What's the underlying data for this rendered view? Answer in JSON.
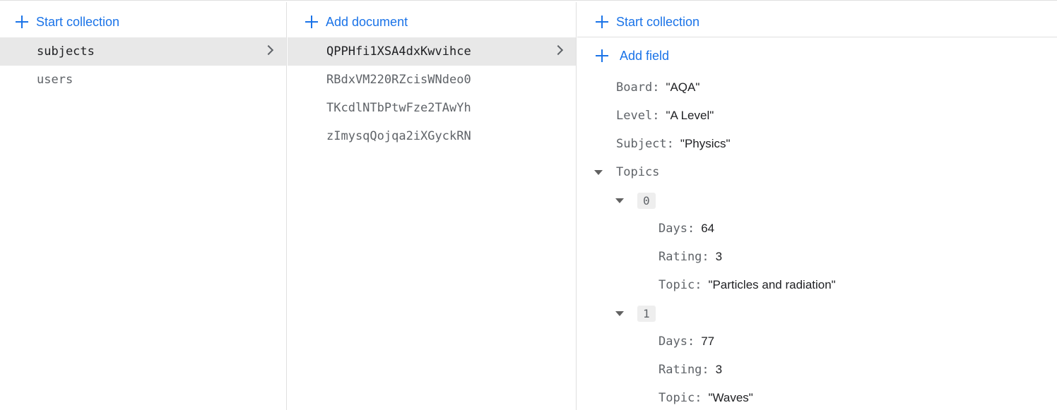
{
  "collections_panel": {
    "add_label": "Start collection",
    "items": [
      {
        "label": "subjects",
        "selected": true
      },
      {
        "label": "users",
        "selected": false
      }
    ]
  },
  "documents_panel": {
    "add_label": "Add document",
    "items": [
      {
        "label": "QPPHfi1XSA4dxKwvihce",
        "selected": true
      },
      {
        "label": "RBdxVM220RZcisWNdeo0",
        "selected": false
      },
      {
        "label": "TKcdlNTbPtwFze2TAwYh",
        "selected": false
      },
      {
        "label": "zImysqQojqa2iXGyckRN",
        "selected": false
      }
    ]
  },
  "document_panel": {
    "start_collection_label": "Start collection",
    "add_field_label": "Add field",
    "fields": {
      "board": {
        "key": "Board",
        "value": "\"AQA\""
      },
      "level": {
        "key": "Level",
        "value": "\"A Level\""
      },
      "subject": {
        "key": "Subject",
        "value": "\"Physics\""
      }
    },
    "topics": {
      "key": "Topics",
      "items": [
        {
          "index": "0",
          "days": {
            "key": "Days",
            "value": "64"
          },
          "rating": {
            "key": "Rating",
            "value": "3"
          },
          "topic": {
            "key": "Topic",
            "value": "\"Particles and radiation\""
          }
        },
        {
          "index": "1",
          "days": {
            "key": "Days",
            "value": "77"
          },
          "rating": {
            "key": "Rating",
            "value": "3"
          },
          "topic": {
            "key": "Topic",
            "value": "\"Waves\""
          }
        }
      ]
    }
  },
  "colors": {
    "accent": "#1a73e8",
    "selected_row": "#e8e8e8",
    "border": "#e0e0e0"
  },
  "icons": [
    "plus-icon",
    "chevron-right-icon",
    "triangle-down-icon"
  ]
}
